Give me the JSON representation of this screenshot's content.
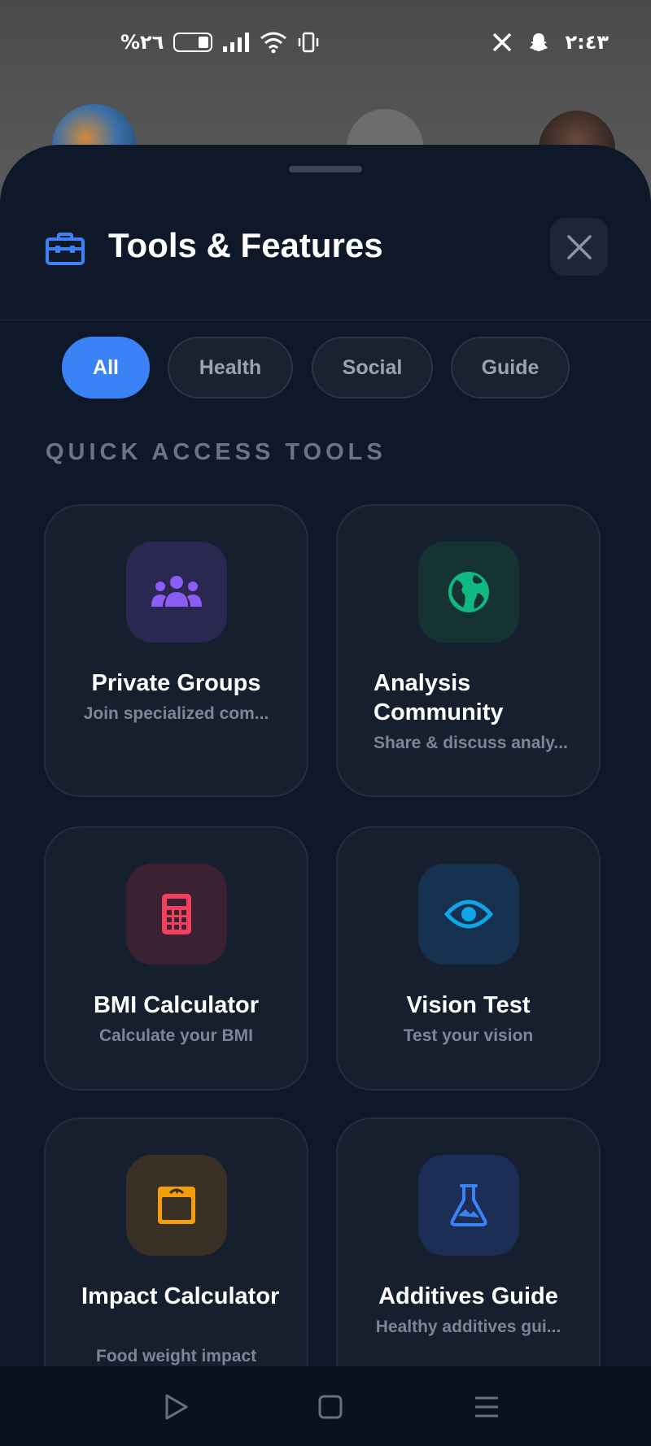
{
  "status_bar": {
    "battery_text": "%٢٦",
    "time": "٢:٤٣"
  },
  "sheet": {
    "title": "Tools & Features",
    "icon": "toolbox-icon",
    "close_icon": "close-icon"
  },
  "filters": [
    {
      "label": "All",
      "active": true
    },
    {
      "label": "Health",
      "active": false
    },
    {
      "label": "Social",
      "active": false
    },
    {
      "label": "Guide",
      "active": false
    }
  ],
  "section": {
    "label": "QUICK ACCESS TOOLS"
  },
  "tools": [
    {
      "title": "Private Groups",
      "subtitle": "Join specialized com...",
      "icon": "groups-icon",
      "color": "#8b5cf6"
    },
    {
      "title": "Analysis Community",
      "subtitle": "Share & discuss analy...",
      "icon": "globe-icon",
      "color": "#10b981"
    },
    {
      "title": "BMI Calculator",
      "subtitle": "Calculate your BMI",
      "icon": "calculator-icon",
      "color": "#f43f5e"
    },
    {
      "title": "Vision Test",
      "subtitle": "Test your vision",
      "icon": "eye-icon",
      "color": "#0ea5e9"
    },
    {
      "title": "Impact Calculator",
      "subtitle": "Food weight impact",
      "icon": "scale-icon",
      "color": "#f59e0b"
    },
    {
      "title": "Additives Guide",
      "subtitle": "Healthy additives gui...",
      "icon": "flask-icon",
      "color": "#3b82f6"
    }
  ],
  "colors": {
    "accent": "#3b82f6",
    "sheet_bg": "#0f1829",
    "card_bg": "#161f2e"
  }
}
